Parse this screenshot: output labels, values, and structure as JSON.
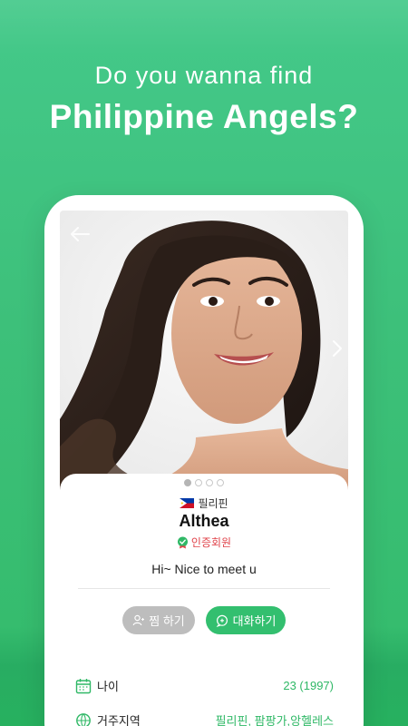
{
  "hero": {
    "line1": "Do you wanna find",
    "line2": "Philippine Angels?"
  },
  "profile": {
    "country": "필리핀",
    "name": "Althea",
    "verified": "인증회원",
    "greeting": "Hi~ Nice to meet u",
    "photo_count": 4,
    "photo_index": 1
  },
  "actions": {
    "like_label": "찜 하기",
    "chat_label": "대화하기"
  },
  "details": [
    {
      "label": "나이",
      "value": "23  (1997)",
      "icon": "calendar-icon"
    },
    {
      "label": "거주지역",
      "value": "필리핀, 팜팡가,앙헬레스",
      "icon": "location-icon"
    }
  ],
  "colors": {
    "brand_green": "#33bf6f",
    "verified_red": "#e0434a",
    "disabled_gray": "#bdbdbd"
  }
}
